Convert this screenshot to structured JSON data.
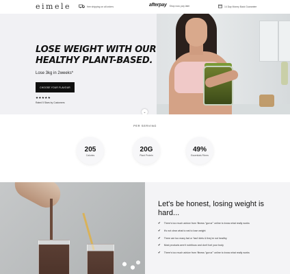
{
  "header": {
    "logo": "eimele",
    "shipping": "free shipping on all orders",
    "afterpay_logo": "afterpay",
    "afterpay_text": "Shop now, pay later",
    "guarantee": "14 Day Money Back Guarantee"
  },
  "hero": {
    "title": "LOSE WEIGHT WITH OUR HEALTHY PLANT-BASED.",
    "subtitle": "Lose 3kg in 2weeks*",
    "cta": "CHOOSE YOUR FLAVOUR",
    "stars": "★★★★★",
    "rating": "Rated 5 Stars by Customers"
  },
  "per_serving": {
    "heading": "PER SERVING",
    "stats": [
      {
        "value": "205",
        "label": "Calories"
      },
      {
        "value": "20G",
        "label": "Plant Protein"
      },
      {
        "value": "49%",
        "label": "Essentials Fibres"
      }
    ]
  },
  "honest": {
    "title": "Let's be honest, losing weight is hard...",
    "bullets": [
      "There's too much advice from 'fitness \"gurus\"' online to know what really works",
      "It's not clear what to eat to lose weight",
      "There are too many fad or 'fast' diets & they're not healthy",
      "Most products aren't nutritious and don't fuel your body",
      "There's too much advice from 'fitness \"gurus\"' online to know what really works"
    ]
  }
}
